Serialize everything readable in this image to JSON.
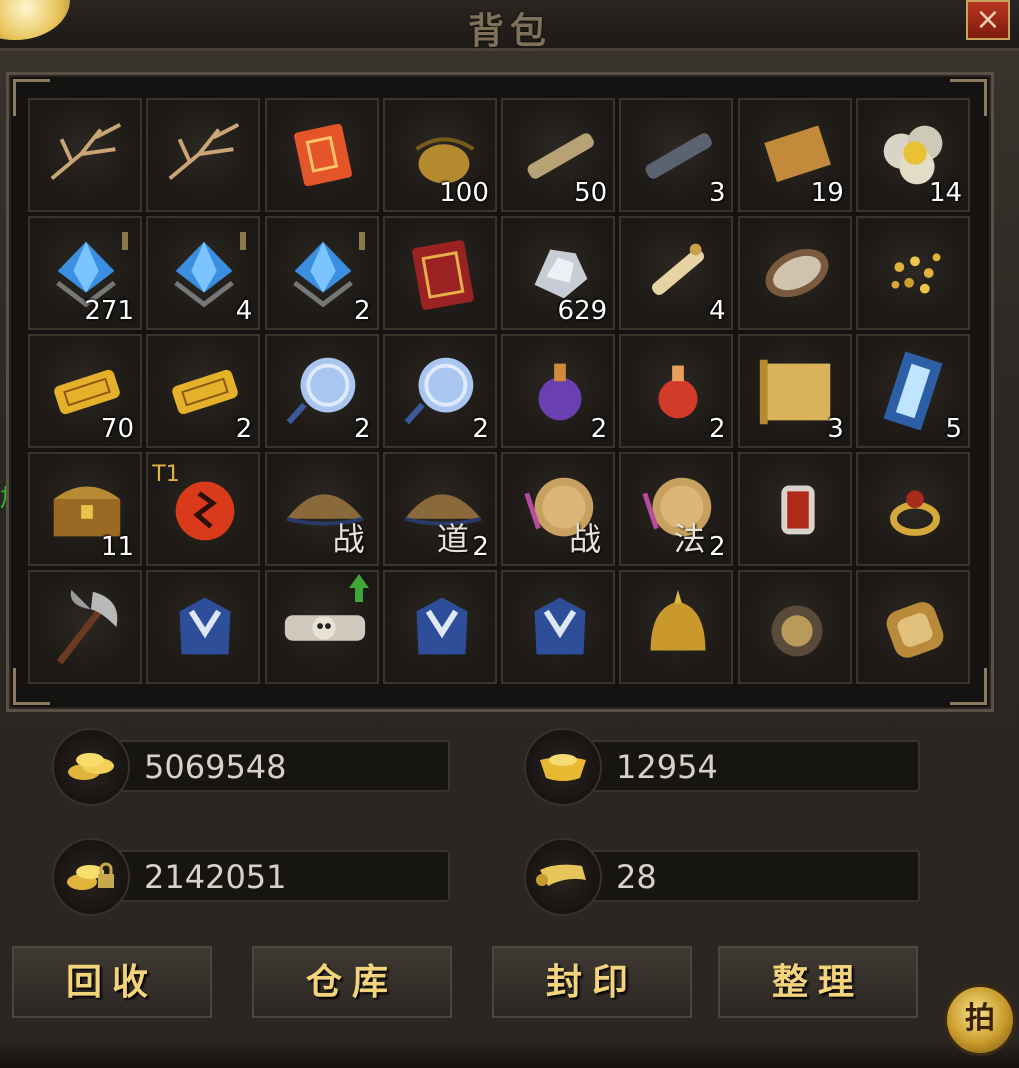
{
  "window": {
    "title": "背包",
    "close_label": "×"
  },
  "side_text": "加.",
  "inventory": [
    {
      "icon": "branch-icon",
      "count": ""
    },
    {
      "icon": "branch-icon",
      "count": ""
    },
    {
      "icon": "red-scroll-icon",
      "count": ""
    },
    {
      "icon": "pouch-icon",
      "count": "100"
    },
    {
      "icon": "scroll-icon",
      "count": "50"
    },
    {
      "icon": "dark-scroll-icon",
      "count": "3"
    },
    {
      "icon": "paper-icon",
      "count": "19"
    },
    {
      "icon": "gold-ore-icon",
      "count": "14"
    },
    {
      "icon": "blue-gem-icon",
      "count": "271"
    },
    {
      "icon": "blue-gem-icon",
      "count": "4"
    },
    {
      "icon": "blue-gem-icon",
      "count": "2"
    },
    {
      "icon": "red-book-icon",
      "count": ""
    },
    {
      "icon": "silver-ore-icon",
      "count": "629"
    },
    {
      "icon": "rolled-scroll-icon",
      "count": "4"
    },
    {
      "icon": "seed-icon",
      "count": ""
    },
    {
      "icon": "gold-shards-icon",
      "count": ""
    },
    {
      "icon": "gold-ticket-icon",
      "count": "70"
    },
    {
      "icon": "gold-ticket-icon",
      "count": "2"
    },
    {
      "icon": "blue-mirror-icon",
      "count": "2"
    },
    {
      "icon": "blue-mirror-icon",
      "count": "2"
    },
    {
      "icon": "purple-potion-icon",
      "count": "2"
    },
    {
      "icon": "red-potion-icon",
      "count": "2"
    },
    {
      "icon": "map-scroll-icon",
      "count": "3"
    },
    {
      "icon": "crystal-card-icon",
      "count": "5"
    },
    {
      "icon": "treasure-chest-icon",
      "count": "11"
    },
    {
      "icon": "red-rune-icon",
      "count": "",
      "tier": "T1"
    },
    {
      "icon": "straw-hat-icon",
      "count": "",
      "glyph": "战"
    },
    {
      "icon": "straw-hat-icon",
      "count": "2",
      "glyph": "道"
    },
    {
      "icon": "round-shield-icon",
      "count": "",
      "glyph": "战"
    },
    {
      "icon": "round-shield-icon",
      "count": "2",
      "glyph": "法"
    },
    {
      "icon": "bracelet-icon",
      "count": ""
    },
    {
      "icon": "ring-icon",
      "count": ""
    },
    {
      "icon": "axe-icon",
      "count": ""
    },
    {
      "icon": "blue-armor-icon",
      "count": ""
    },
    {
      "icon": "skull-belt-icon",
      "count": "",
      "upgrade": true
    },
    {
      "icon": "blue-armor-icon",
      "count": ""
    },
    {
      "icon": "blue-armor-icon",
      "count": ""
    },
    {
      "icon": "gold-helmet-icon",
      "count": ""
    },
    {
      "icon": "dark-boots-icon",
      "count": ""
    },
    {
      "icon": "gold-boots-icon",
      "count": ""
    }
  ],
  "currencies": {
    "gold": {
      "icon": "gold-coins-icon",
      "value": "5069548"
    },
    "ingot": {
      "icon": "gold-ingot-icon",
      "value": "12954"
    },
    "bound_gold": {
      "icon": "locked-coins-icon",
      "value": "2142051"
    },
    "scroll": {
      "icon": "scroll-token-icon",
      "value": "28"
    }
  },
  "buttons": {
    "recycle": "回收",
    "warehouse": "仓库",
    "seal": "封印",
    "sort": "整理"
  },
  "auction_label": "拍",
  "colors": {
    "gold_text": "#f3d47a",
    "count_text": "#ffffff",
    "side_text": "#2fbf2f",
    "close_bg": "#b8361f"
  }
}
